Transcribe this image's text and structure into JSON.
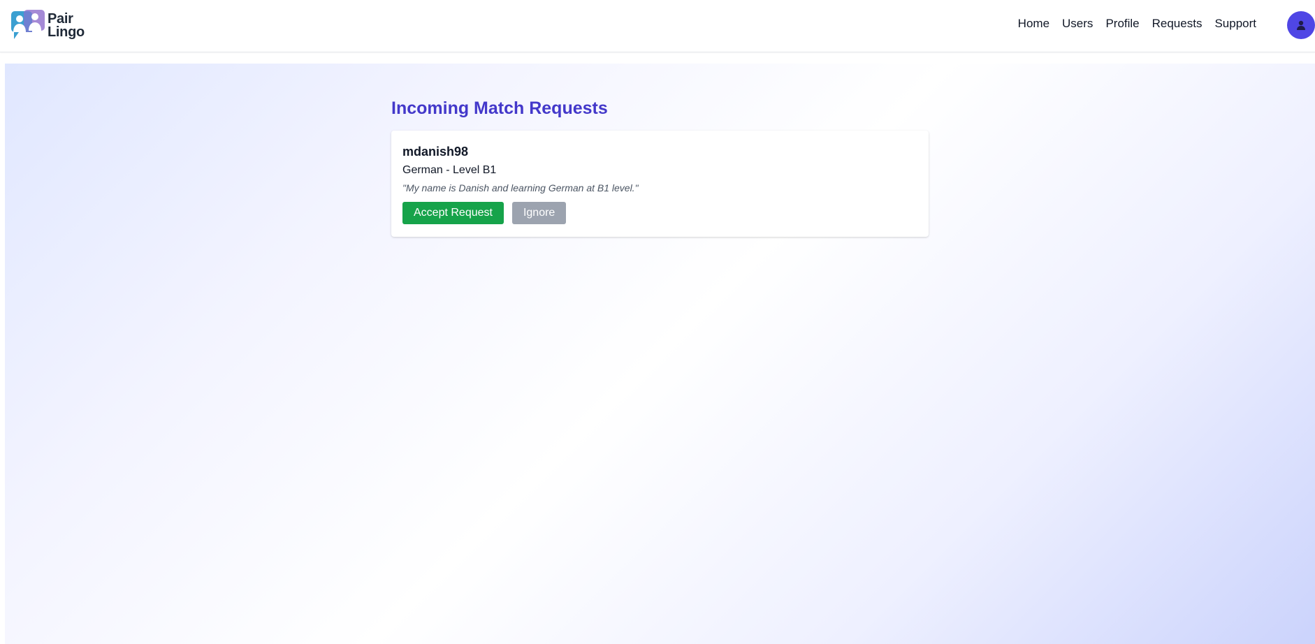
{
  "brand": {
    "name_line1": "Pair",
    "name_line2": "Lingo",
    "icon": "two-people-chat-logo-icon"
  },
  "nav": {
    "links": [
      {
        "label": "Home"
      },
      {
        "label": "Users"
      },
      {
        "label": "Profile"
      },
      {
        "label": "Requests"
      },
      {
        "label": "Support"
      }
    ],
    "avatar_icon": "user-icon"
  },
  "page": {
    "title": "Incoming Match Requests"
  },
  "requests": [
    {
      "username": "mdanish98",
      "language": "German - Level B1",
      "message": "\"My name is Danish and learning German at B1 level.\"",
      "accept_label": "Accept Request",
      "ignore_label": "Ignore"
    }
  ],
  "colors": {
    "accent": "#4338ca",
    "avatar": "#4f46e5",
    "accept": "#16a34a",
    "ignore": "#9ca3af"
  }
}
